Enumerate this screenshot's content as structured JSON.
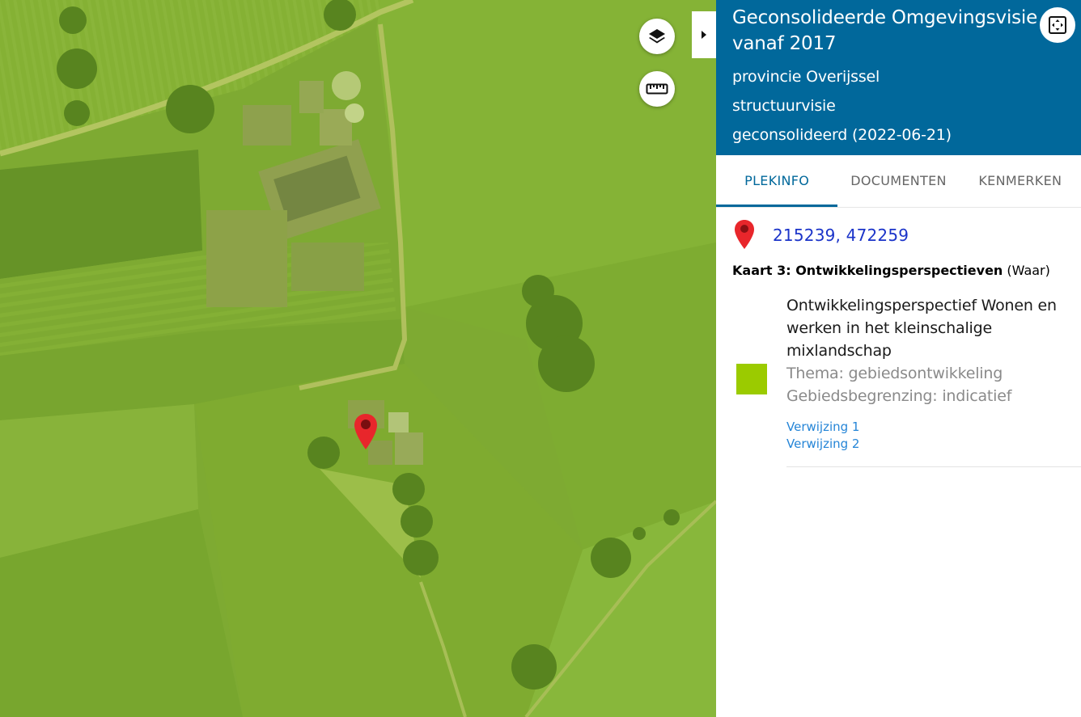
{
  "panel": {
    "title": "Geconsolideerde Omgevingsvisie vanaf 2017",
    "meta": [
      "provincie Overijssel",
      "structuurvisie",
      "geconsolideerd (2022-06-21)"
    ],
    "tabs": [
      {
        "label": "PLEKINFO",
        "active": true
      },
      {
        "label": "DOCUMENTEN",
        "active": false
      },
      {
        "label": "KENMERKEN",
        "active": false
      }
    ],
    "coordinates": "215239, 472259",
    "map_name_bold": "Kaart 3: Ontwikkelingsperspectieven",
    "map_name_suffix": " (Waar)",
    "feature": {
      "title": "Ontwikkelingsperspectief Wonen en werken in het kleinschalige mixlandschap",
      "theme": "Thema: gebiedsontwikkeling",
      "boundary": "Gebiedsbegrenzing: indicatief",
      "swatch_color": "#9bcb00",
      "references": [
        "Verwijzing 1",
        "Verwijzing 2"
      ]
    }
  },
  "map": {
    "controls": [
      "layers-icon",
      "ruler-icon"
    ],
    "marker_color": "#e8262b",
    "header_color": "#01689b"
  }
}
